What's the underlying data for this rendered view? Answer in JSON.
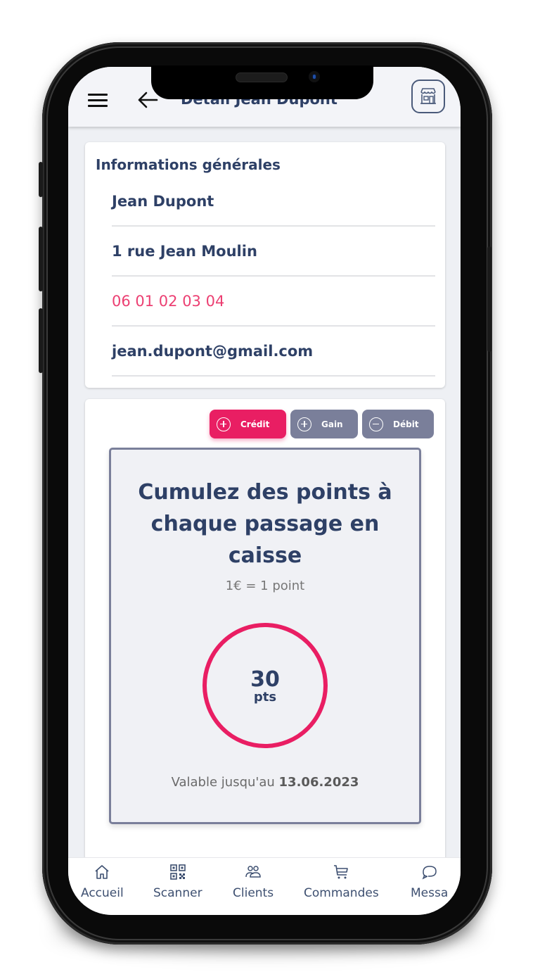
{
  "header": {
    "title": "Détail Jean Dupont",
    "menu_icon": "hamburger-menu-icon",
    "back_icon": "arrow-left-icon",
    "store_icon": "storefront-icon"
  },
  "info_card": {
    "title": "Informations générales",
    "name": "Jean Dupont",
    "address": "1 rue Jean Moulin",
    "phone": "06 01 02 03 04",
    "email": "jean.dupont@gmail.com"
  },
  "loyalty": {
    "actions": [
      {
        "label": "Crédit",
        "icon": "plus-circle-icon",
        "color": "#e91e63"
      },
      {
        "label": "Gain",
        "icon": "plus-circle-icon",
        "color": "#7a7f9a"
      },
      {
        "label": "Débit",
        "icon": "minus-circle-icon",
        "color": "#7a7f9a"
      }
    ],
    "title": "Cumulez des points à chaque passage en caisse",
    "rate": "1€ = 1 point",
    "points": "30",
    "points_unit": "pts",
    "validity_label": "Valable jusqu'au",
    "validity_date": "13.06.2023"
  },
  "bottom_nav": [
    {
      "label": "Accueil",
      "icon": "home-icon"
    },
    {
      "label": "Scanner",
      "icon": "qr-code-icon"
    },
    {
      "label": "Clients",
      "icon": "users-icon"
    },
    {
      "label": "Commandes",
      "icon": "cart-icon"
    },
    {
      "label": "Messages",
      "icon": "chat-icon",
      "visible_label": "Messa"
    }
  ],
  "colors": {
    "primary_text": "#2e4066",
    "accent": "#e91e63",
    "secondary_button": "#7a7f9a",
    "phone_link": "#ec3f72"
  }
}
